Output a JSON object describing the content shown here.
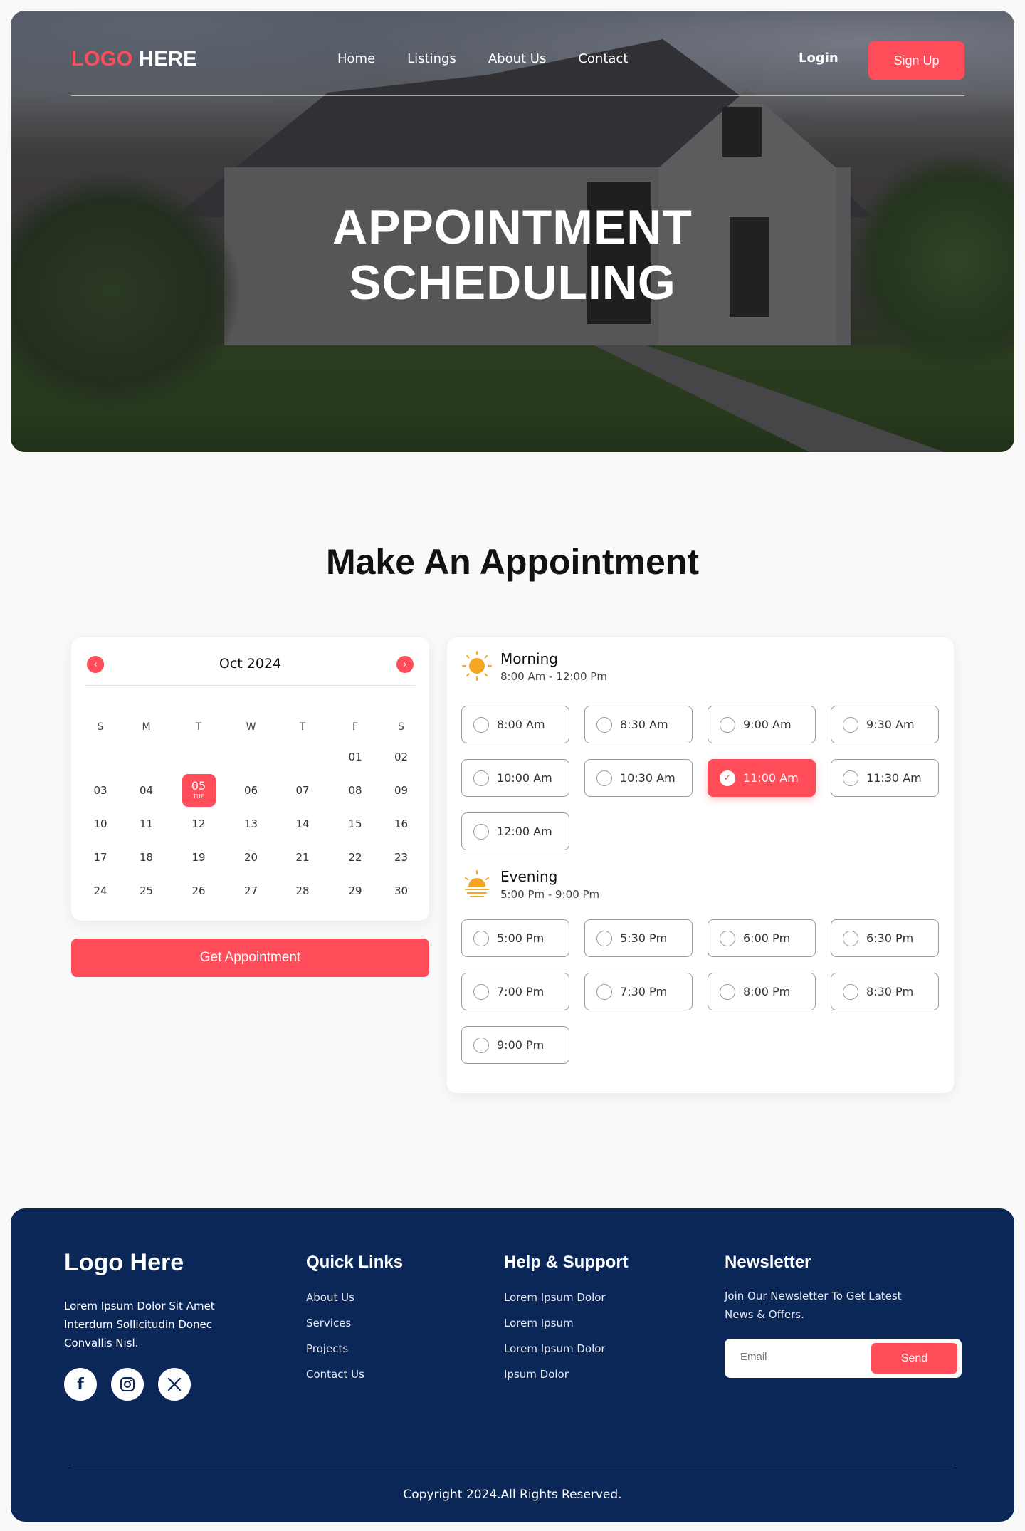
{
  "header": {
    "logo_part1": "LOGO",
    "logo_part2": "HERE",
    "nav": [
      "Home",
      "Listings",
      "About Us",
      "Contact"
    ],
    "login": "Login",
    "signup": "Sign Up"
  },
  "hero": {
    "title_line1": "APPOINTMENT",
    "title_line2": "SCHEDULING"
  },
  "section": {
    "title": "Make An Appointment"
  },
  "calendar": {
    "month_label": "Oct 2024",
    "prev_icon": "chevron-left-icon",
    "next_icon": "chevron-right-icon",
    "weekdays": [
      "S",
      "M",
      "T",
      "W",
      "T",
      "F",
      "S"
    ],
    "weeks": [
      [
        "",
        "",
        "",
        "",
        "",
        "01",
        "02"
      ],
      [
        "03",
        "04",
        "05",
        "06",
        "07",
        "08",
        "09"
      ],
      [
        "10",
        "11",
        "12",
        "13",
        "14",
        "15",
        "16"
      ],
      [
        "17",
        "18",
        "19",
        "20",
        "21",
        "22",
        "23"
      ],
      [
        "24",
        "25",
        "26",
        "27",
        "28",
        "29",
        "30"
      ]
    ],
    "selected_day": "05",
    "selected_weekday": "TUE",
    "button": "Get Appointment"
  },
  "morning": {
    "icon": "sun-icon",
    "name": "Morning",
    "range": "8:00 Am - 12:00 Pm",
    "slots": [
      "8:00 Am",
      "8:30 Am",
      "9:00 Am",
      "9:30 Am",
      "10:00 Am",
      "10:30 Am",
      "11:00 Am",
      "11:30 Am",
      "12:00 Am"
    ]
  },
  "evening": {
    "icon": "sunset-icon",
    "name": "Evening",
    "range": "5:00 Pm - 9:00 Pm",
    "slots": [
      "5:00 Pm",
      "5:30 Pm",
      "6:00 Pm",
      "6:30 Pm",
      "7:00 Pm",
      "7:30 Pm",
      "8:00 Pm",
      "8:30 Pm",
      "9:00 Pm"
    ]
  },
  "selected_slot": "11:00 Am",
  "footer": {
    "logo": "Logo Here",
    "about": "Lorem Ipsum Dolor Sit Amet Interdum Sollicitudin Donec Convallis Nisl.",
    "socials": [
      "facebook-icon",
      "instagram-icon",
      "x-icon"
    ],
    "quick_links_title": "Quick Links",
    "quick_links": [
      "About Us",
      "Services",
      "Projects",
      "Contact Us"
    ],
    "help_title": "Help & Support",
    "help_links": [
      "Lorem Ipsum Dolor",
      "Lorem Ipsum",
      "Lorem Ipsum Dolor",
      "Ipsum Dolor"
    ],
    "newsletter_title": "Newsletter",
    "newsletter_text": "Join Our Newsletter To Get Latest News & Offers.",
    "email_placeholder": "Email",
    "send": "Send",
    "copyright": "Copyright 2024.All Rights Reserved."
  },
  "colors": {
    "accent": "#ff4d5a",
    "footer_bg": "#0b2758",
    "sun": "#f5a623"
  }
}
